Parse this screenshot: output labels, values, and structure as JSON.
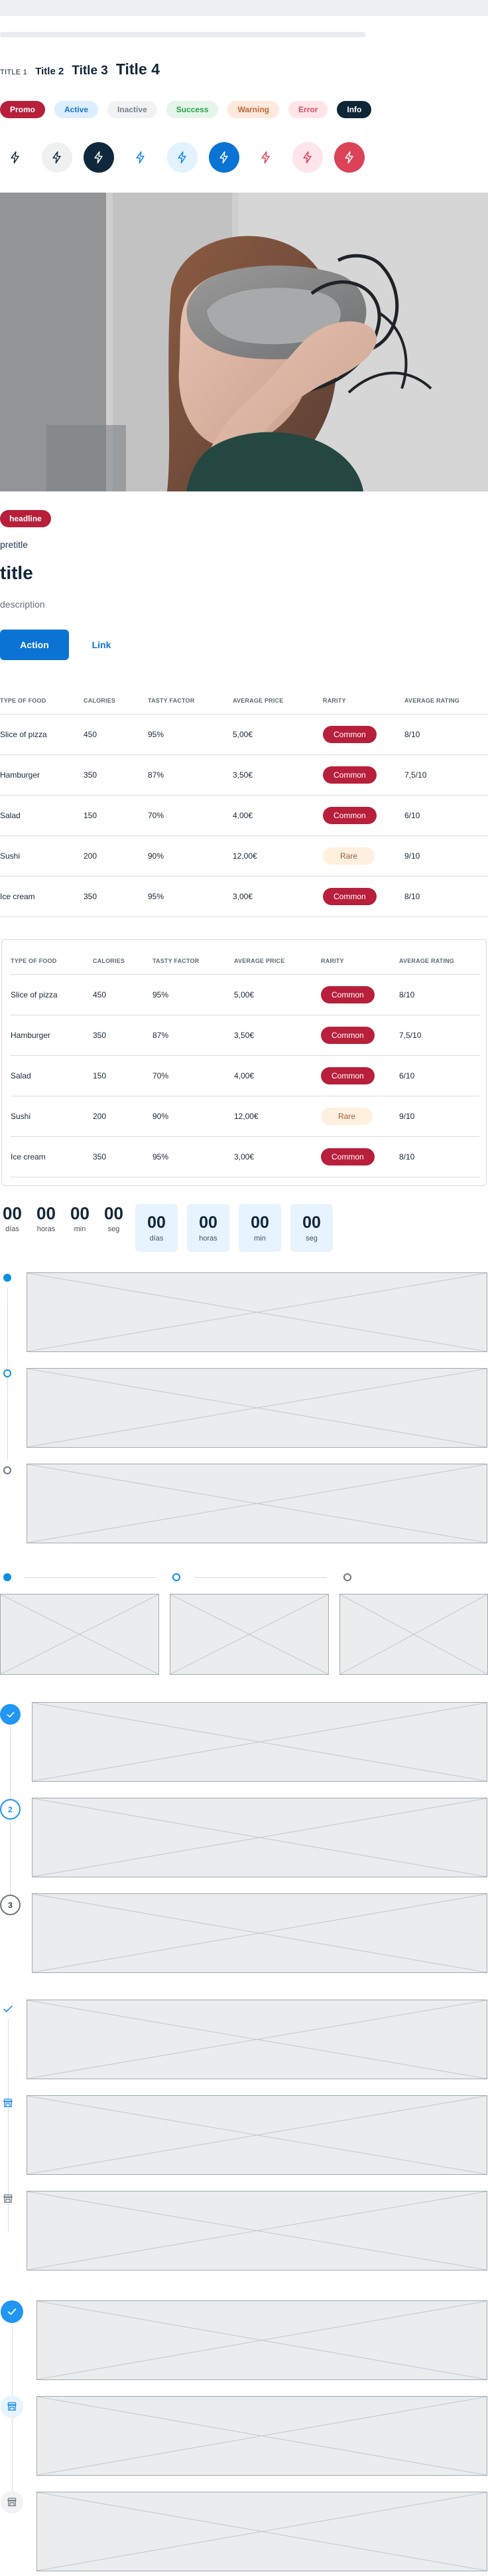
{
  "titles": {
    "title1": "TITLE 1",
    "title2": "Title 2",
    "title3": "Title 3",
    "title4": "Title 4"
  },
  "badges": [
    {
      "label": "Promo"
    },
    {
      "label": "Active"
    },
    {
      "label": "Inactive"
    },
    {
      "label": "Success"
    },
    {
      "label": "Warning"
    },
    {
      "label": "Error"
    },
    {
      "label": "Info"
    }
  ],
  "icons": {
    "row": [
      "lightning-icon",
      "lightning-icon",
      "lightning-icon",
      "lightning-icon",
      "lightning-icon",
      "lightning-icon",
      "lightning-icon",
      "lightning-icon",
      "lightning-icon"
    ]
  },
  "content": {
    "headline": "headline",
    "pretitle": "pretitle",
    "title": "title",
    "description": "description",
    "primary_action": "Action",
    "link_action": "Link"
  },
  "food_table": {
    "columns": [
      "TYPE OF FOOD",
      "CALORIES",
      "TASTY FACTOR",
      "AVERAGE PRICE",
      "RARITY",
      "AVERAGE RATING"
    ],
    "rows": [
      {
        "type": "Slice of pizza",
        "calories": "450",
        "tasty": "95%",
        "price": "5,00€",
        "rarity": "Common",
        "rating": "8/10"
      },
      {
        "type": "Hamburger",
        "calories": "350",
        "tasty": "87%",
        "price": "3,50€",
        "rarity": "Common",
        "rating": "7,5/10"
      },
      {
        "type": "Salad",
        "calories": "150",
        "tasty": "70%",
        "price": "4,00€",
        "rarity": "Common",
        "rating": "6/10"
      },
      {
        "type": "Sushi",
        "calories": "200",
        "tasty": "90%",
        "price": "12,00€",
        "rarity": "Rare",
        "rating": "9/10"
      },
      {
        "type": "Ice cream",
        "calories": "350",
        "tasty": "95%",
        "price": "3,00€",
        "rarity": "Common",
        "rating": "8/10"
      }
    ]
  },
  "countdown": {
    "plain": [
      {
        "value": "00",
        "label": "días"
      },
      {
        "value": "00",
        "label": "horas"
      },
      {
        "value": "00",
        "label": "min"
      },
      {
        "value": "00",
        "label": "seg"
      }
    ],
    "boxed": [
      {
        "value": "00",
        "label": "días"
      },
      {
        "value": "00",
        "label": "horas"
      },
      {
        "value": "00",
        "label": "min"
      },
      {
        "value": "00",
        "label": "seg"
      }
    ]
  },
  "steppers": {
    "numbered": [
      "2",
      "3"
    ],
    "icons": [
      "check-icon",
      "store-icon",
      "store-icon"
    ]
  },
  "colors": {
    "primary": "#0b73d4",
    "accent": "#0d8fe0",
    "promo": "#b71f3a",
    "dark": "#12263a"
  }
}
